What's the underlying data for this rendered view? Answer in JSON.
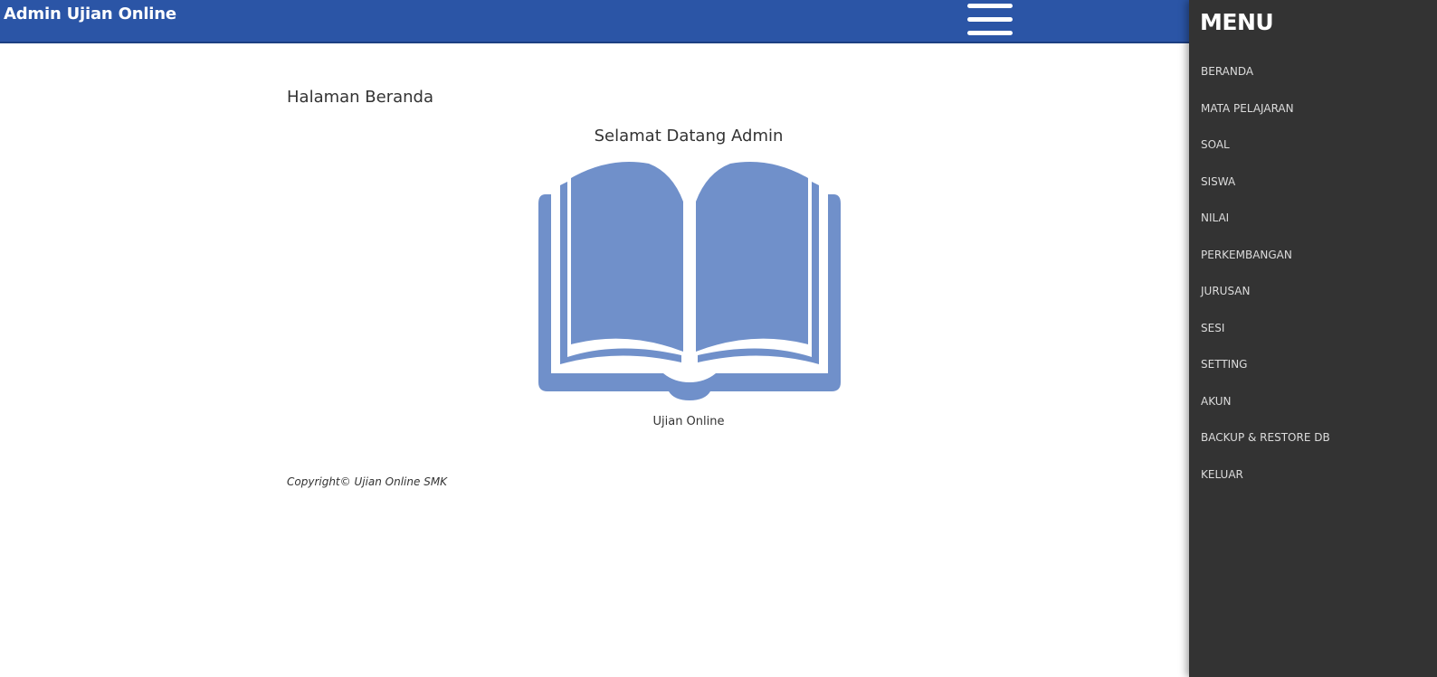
{
  "header": {
    "title": "Admin Ujian Online",
    "menu_toggle_icon": "hamburger-icon",
    "background_color": "#2b55a6"
  },
  "main": {
    "page_title": "Halaman Beranda",
    "welcome_text": "Selamat Datang Admin",
    "book_icon": "open-book-icon",
    "book_color": "#7090ca",
    "book_caption": "Ujian Online",
    "copyright": "Copyright© Ujian Online SMK"
  },
  "sidebar": {
    "heading": "MENU",
    "background_color": "#333333",
    "items": [
      {
        "label": "BERANDA"
      },
      {
        "label": "MATA PELAJARAN"
      },
      {
        "label": "SOAL"
      },
      {
        "label": "SISWA"
      },
      {
        "label": "NILAI"
      },
      {
        "label": "PERKEMBANGAN"
      },
      {
        "label": "JURUSAN"
      },
      {
        "label": "SESI"
      },
      {
        "label": "SETTING"
      },
      {
        "label": "AKUN"
      },
      {
        "label": "BACKUP & RESTORE DB"
      },
      {
        "label": "KELUAR"
      }
    ]
  }
}
